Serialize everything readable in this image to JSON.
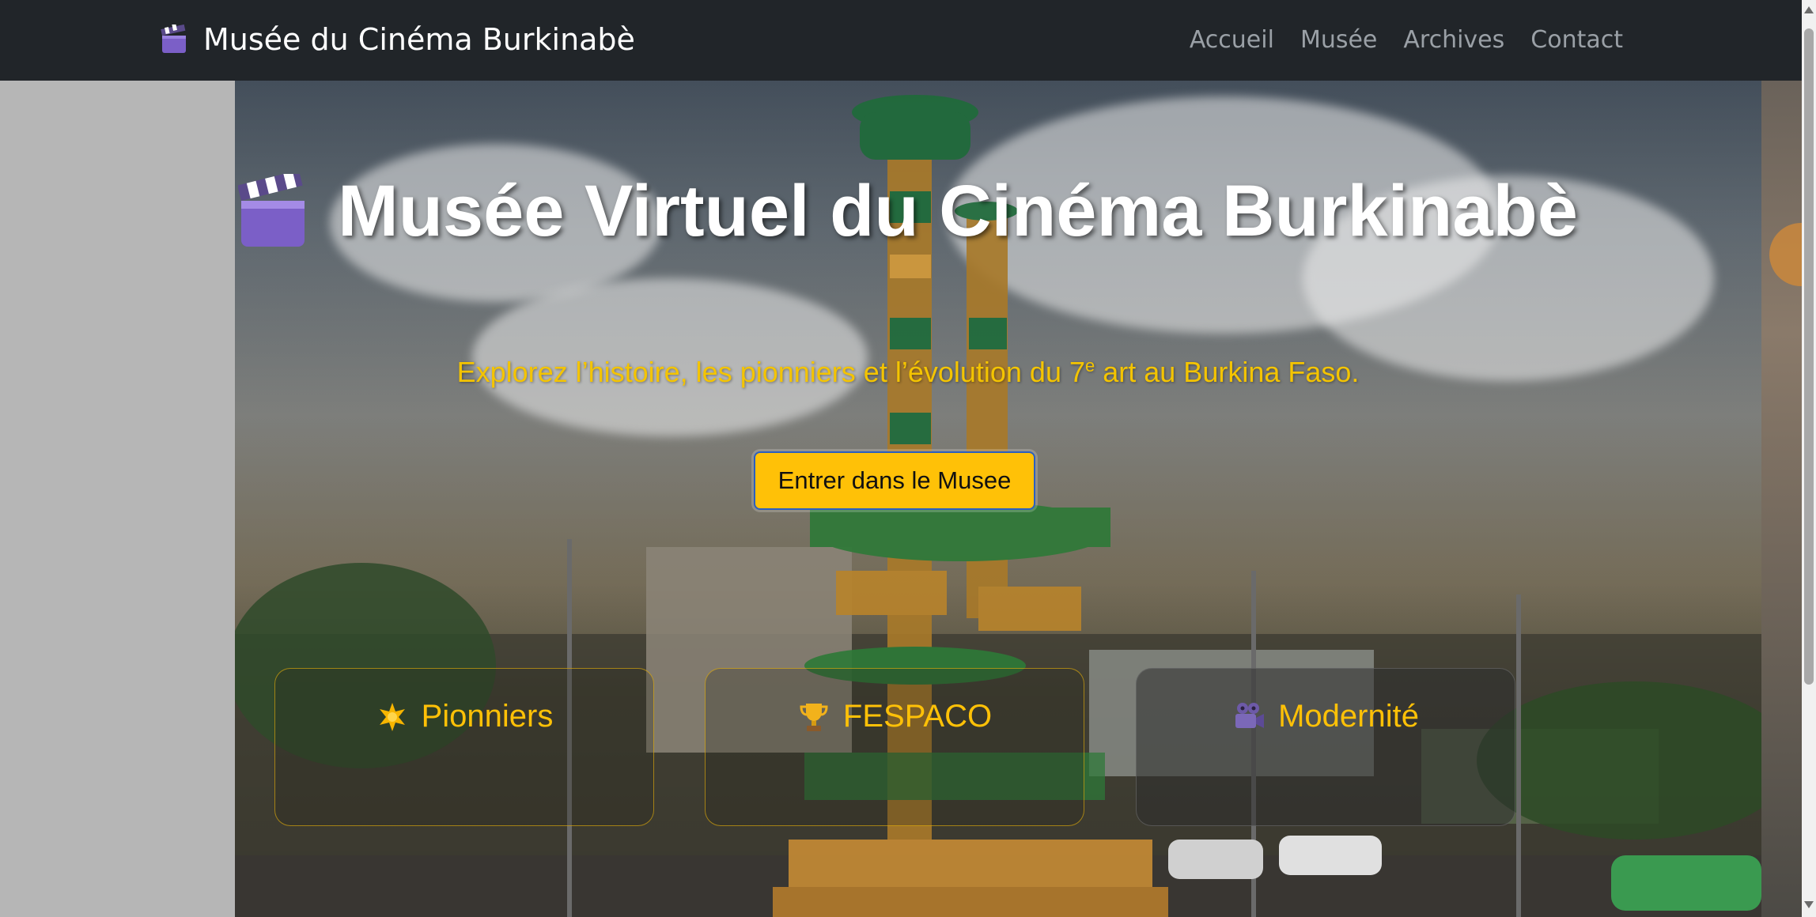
{
  "navbar": {
    "brand_icon": "clapperboard-icon",
    "brand_label": "Musée du Cinéma Burkinabè",
    "links": [
      {
        "label": "Accueil"
      },
      {
        "label": "Musée"
      },
      {
        "label": "Archives"
      },
      {
        "label": "Contact"
      }
    ]
  },
  "hero": {
    "title_icon": "clapperboard-icon",
    "title": "Musée Virtuel du Cinéma Burkinabè",
    "subtitle_before": "Explorez l’histoire, les pionniers et l’évolution du 7",
    "subtitle_sup": "e",
    "subtitle_after": " art au Burkina Faso.",
    "cta_label": "Entrer dans le Musee",
    "cards": [
      {
        "icon": "star-icon",
        "label": "Pionniers"
      },
      {
        "icon": "trophy-icon",
        "label": "FESPACO"
      },
      {
        "icon": "video-camera-icon",
        "label": "Modernité"
      }
    ]
  },
  "colors": {
    "navbar_bg": "#212529",
    "accent_yellow": "#ffc107",
    "nav_link": "#9aa0a6"
  }
}
